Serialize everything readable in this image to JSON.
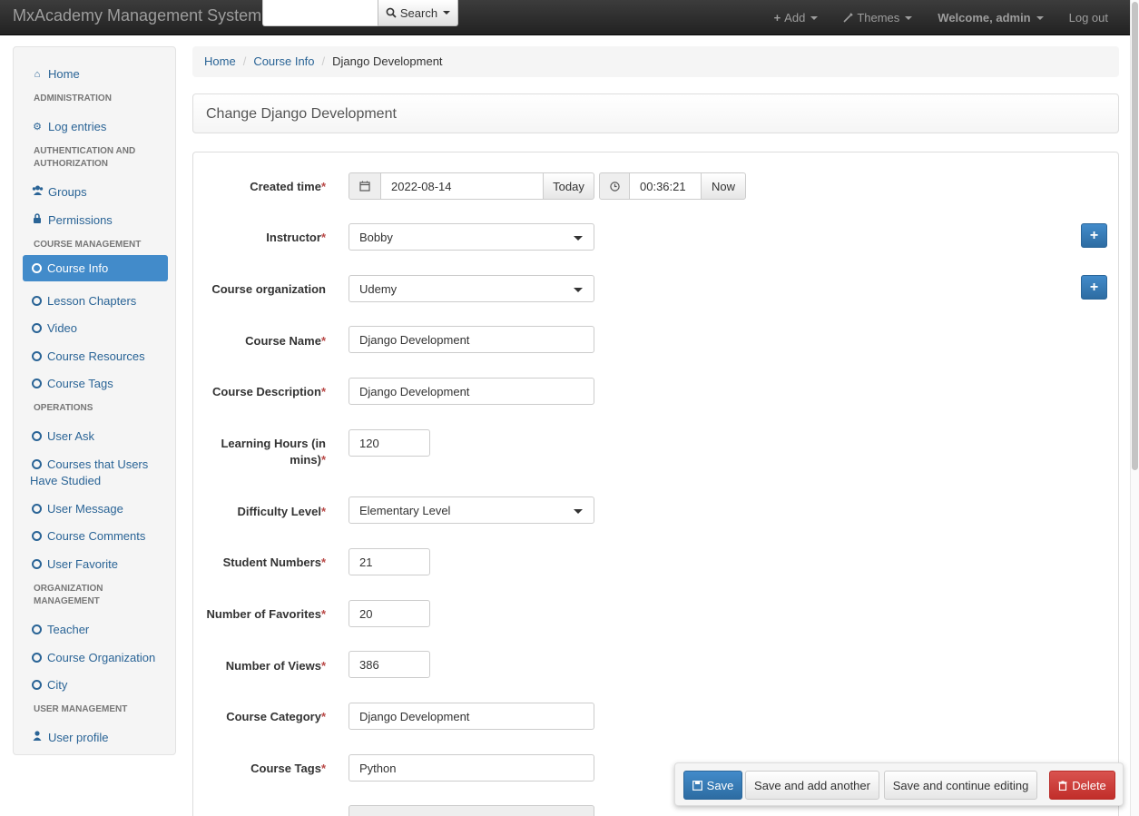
{
  "navbar": {
    "brand": "MxAcademy Management System",
    "search_value": "",
    "search_label": "Search",
    "add_label": "Add",
    "themes_label": "Themes",
    "welcome_label": "Welcome, admin",
    "logout_label": "Log out"
  },
  "sidebar": {
    "home": "Home",
    "sections": {
      "administration": "ADMINISTRATION",
      "auth": "AUTHENTICATION AND AUTHORIZATION",
      "course_mgmt": "COURSE MANAGEMENT",
      "operations": "OPERATIONS",
      "org_mgmt": "ORGANIZATION MANAGEMENT",
      "user_mgmt": "USER MANAGEMENT"
    },
    "items": {
      "log_entries": "Log entries",
      "groups": "Groups",
      "permissions": "Permissions",
      "course_info": "Course Info",
      "lesson_chapters": "Lesson Chapters",
      "video": "Video",
      "course_resources": "Course Resources",
      "course_tags": "Course Tags",
      "user_ask": "User Ask",
      "courses_studied_1": "Courses that Users",
      "courses_studied_2": "Have Studied",
      "user_message": "User Message",
      "course_comments": "Course Comments",
      "user_favorite": "User Favorite",
      "teacher": "Teacher",
      "course_organization": "Course Organization",
      "city": "City",
      "user_profile": "User profile"
    }
  },
  "breadcrumb": {
    "home": "Home",
    "course_info": "Course Info",
    "current": "Django Development",
    "separator": "/"
  },
  "page_title": "Change Django Development",
  "form": {
    "required_mark": "*",
    "created_time": {
      "label": "Created time",
      "date": "2022-08-14",
      "today": "Today",
      "time": "00:36:21",
      "now": "Now"
    },
    "instructor": {
      "label": "Instructor",
      "value": "Bobby"
    },
    "course_organization": {
      "label": "Course organization",
      "value": "Udemy"
    },
    "course_name": {
      "label": "Course Name",
      "value": "Django Development"
    },
    "course_description": {
      "label": "Course Description",
      "value": "Django Development"
    },
    "learning_hours": {
      "label_1": "Learning Hours (in",
      "label_2": "mins)",
      "value": "120"
    },
    "difficulty_level": {
      "label": "Difficulty Level",
      "value": "Elementary Level"
    },
    "student_numbers": {
      "label": "Student Numbers",
      "value": "21"
    },
    "number_of_favorites": {
      "label": "Number of Favorites",
      "value": "20"
    },
    "number_of_views": {
      "label": "Number of Views",
      "value": "386"
    },
    "course_category": {
      "label": "Course Category",
      "value": "Django Development"
    },
    "course_tags": {
      "label": "Course Tags",
      "value": "Python"
    }
  },
  "actions": {
    "save": "Save",
    "save_add_another": "Save and add another",
    "save_continue": "Save and continue editing",
    "delete": "Delete"
  }
}
